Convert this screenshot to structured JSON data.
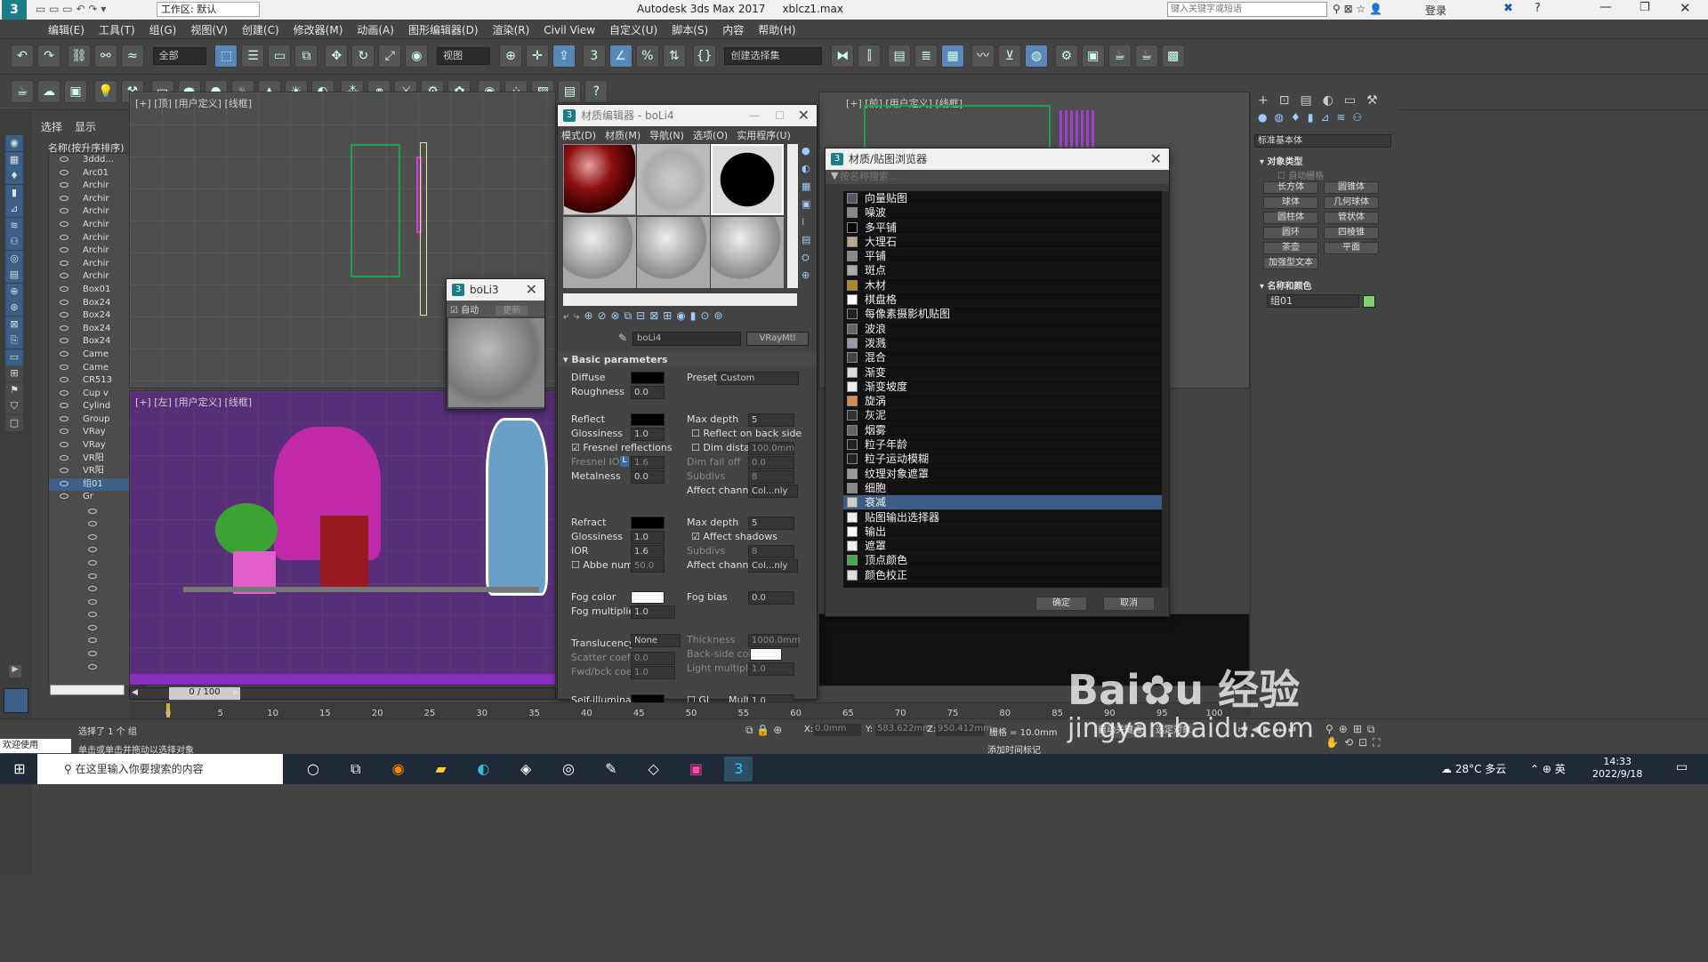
{
  "app": {
    "title": "Autodesk 3ds Max 2017",
    "file": "xblcz1.max",
    "workspace": "工作区: 默认",
    "search_placeholder": "键入关键字或短语",
    "login": "登录"
  },
  "menu": [
    "编辑(E)",
    "工具(T)",
    "组(G)",
    "视图(V)",
    "创建(C)",
    "修改器(M)",
    "动画(A)",
    "图形编辑器(D)",
    "渲染(R)",
    "Civil View",
    "自定义(U)",
    "脚本(S)",
    "内容",
    "帮助(H)"
  ],
  "toolbar": {
    "filter": "全部",
    "view_dropdown": "视图",
    "selection_set": "创建选择集"
  },
  "scene_explorer": {
    "tabs": [
      "选择",
      "显示"
    ],
    "header": "名称(按升序排序)",
    "items": [
      "3ddd...",
      "Arc01",
      "Archir",
      "Archir",
      "Archir",
      "Archir",
      "Archir",
      "Archir",
      "Archir",
      "Archir",
      "Box01",
      "Box24",
      "Box24",
      "Box24",
      "Box24",
      "Came",
      "Came",
      "CR513",
      "Cup v",
      "Cylind",
      "Group",
      "VRay",
      "VRay",
      "VR阳",
      "VR阳",
      "组01",
      "Gr"
    ]
  },
  "viewports": {
    "top": "[+] [顶] [用户定义] [线框]",
    "left": "[+] [左] [用户定义] [线框]",
    "front": "[+] [前] [用户定义] [线框]",
    "time_slider": "0 / 100"
  },
  "boli3": {
    "title": "boLi3",
    "auto": "自动",
    "update": "更新"
  },
  "material_editor": {
    "title": "材质编辑器 - boLi4",
    "menu": [
      "模式(D)",
      "材质(M)",
      "导航(N)",
      "选项(O)",
      "实用程序(U)"
    ],
    "material_name": "boLi4",
    "material_type": "VRayMtl",
    "rollout": "Basic parameters",
    "params": {
      "diffuse": "Diffuse",
      "preset": "Preset",
      "preset_value": "Custom",
      "roughness": "Roughness",
      "roughness_value": "0.0",
      "reflect": "Reflect",
      "max_depth": "Max depth",
      "max_depth_value": "5",
      "glossiness": "Glossiness",
      "glossiness_value": "1.0",
      "reflect_back": "Reflect on back side",
      "fresnel": "Fresnel reflections",
      "dim_distance": "Dim distance",
      "dim_distance_value": "100.0mm",
      "fresnel_ior": "Fresnel IOR",
      "fresnel_ior_value": "1.6",
      "fresnel_lock": "L",
      "dim_falloff": "Dim fall off",
      "dim_falloff_value": "0.0",
      "metalness": "Metalness",
      "metalness_value": "0.0",
      "subdivs": "Subdivs",
      "subdivs_value": "8",
      "affect_channels": "Affect channels",
      "affect_channels_value": "Col...nly",
      "refract": "Refract",
      "refract_max_depth_value": "5",
      "refract_glossiness_value": "1.0",
      "affect_shadows": "Affect shadows",
      "ior": "IOR",
      "ior_value": "1.6",
      "refract_subdivs_value": "8",
      "abbe": "Abbe number",
      "abbe_value": "50.0",
      "refract_channels_value": "Col...nly",
      "fog_color": "Fog color",
      "fog_bias": "Fog bias",
      "fog_bias_value": "0.0",
      "fog_multiplier": "Fog multiplier",
      "fog_multiplier_value": "1.0",
      "thickness": "Thickness",
      "thickness_value": "1000.0mm",
      "translucency": "Translucency",
      "translucency_value": "None",
      "back_side_color": "Back-side color",
      "scatter": "Scatter coeff",
      "scatter_value": "0.0",
      "light_mult": "Light multiplier",
      "light_mult_value": "1.0",
      "fwd_bck": "Fwd/bck coeff",
      "fwd_bck_value": "1.0",
      "self_illum": "Self-illumination",
      "gi": "GI",
      "mult": "Mult",
      "mult_value": "1.0"
    }
  },
  "map_browser": {
    "title": "材质/贴图浏览器",
    "search_placeholder": "按名称搜索...",
    "items": [
      "向量贴图",
      "噪波",
      "多平铺",
      "大理石",
      "平铺",
      "斑点",
      "木材",
      "棋盘格",
      "每像素摄影机贴图",
      "波浪",
      "泼溅",
      "混合",
      "渐变",
      "渐变坡度",
      "旋涡",
      "灰泥",
      "烟雾",
      "粒子年龄",
      "粒子运动模糊",
      "纹理对象遮罩",
      "细胞",
      "衰减",
      "贴图输出选择器",
      "输出",
      "遮罩",
      "顶点颜色",
      "颜色校正"
    ],
    "selected": "衰减",
    "ok": "确定",
    "cancel": "取消"
  },
  "command_panel": {
    "dropdown": "标准基本体",
    "object_type": "对象类型",
    "autogrid": "自动栅格",
    "buttons": [
      "长方体",
      "圆锥体",
      "球体",
      "几何球体",
      "圆柱体",
      "管状体",
      "圆环",
      "四棱锥",
      "茶壶",
      "平面",
      "加强型文本"
    ],
    "name_color": "名称和颜色",
    "name_value": "组01"
  },
  "timeline": {
    "ticks": [
      "0",
      "5",
      "10",
      "15",
      "20",
      "25",
      "30",
      "35",
      "40",
      "45",
      "50",
      "55",
      "60",
      "65",
      "70",
      "75",
      "80",
      "85",
      "90",
      "95",
      "100"
    ]
  },
  "status": {
    "selected": "选择了 1 个 组",
    "prompt": "单击或单击并拖动以选择对象",
    "welcome": "欢迎使用 MAXSc",
    "x_label": "X:",
    "x": "0.0mm",
    "y_label": "Y:",
    "y": "583.622mm",
    "z_label": "Z:",
    "z": "950.412mm",
    "grid": "栅格 = 10.0mm",
    "add_time_tag": "添加时间标记",
    "auto_key": "自动关键点",
    "set_key": "选定对象"
  },
  "taskbar": {
    "search": "在这里输入你要搜索的内容",
    "weather": "28°C 多云",
    "lang": "英",
    "time": "14:33",
    "date": "2022/9/18"
  },
  "watermark": "jingyan.baidu.com"
}
